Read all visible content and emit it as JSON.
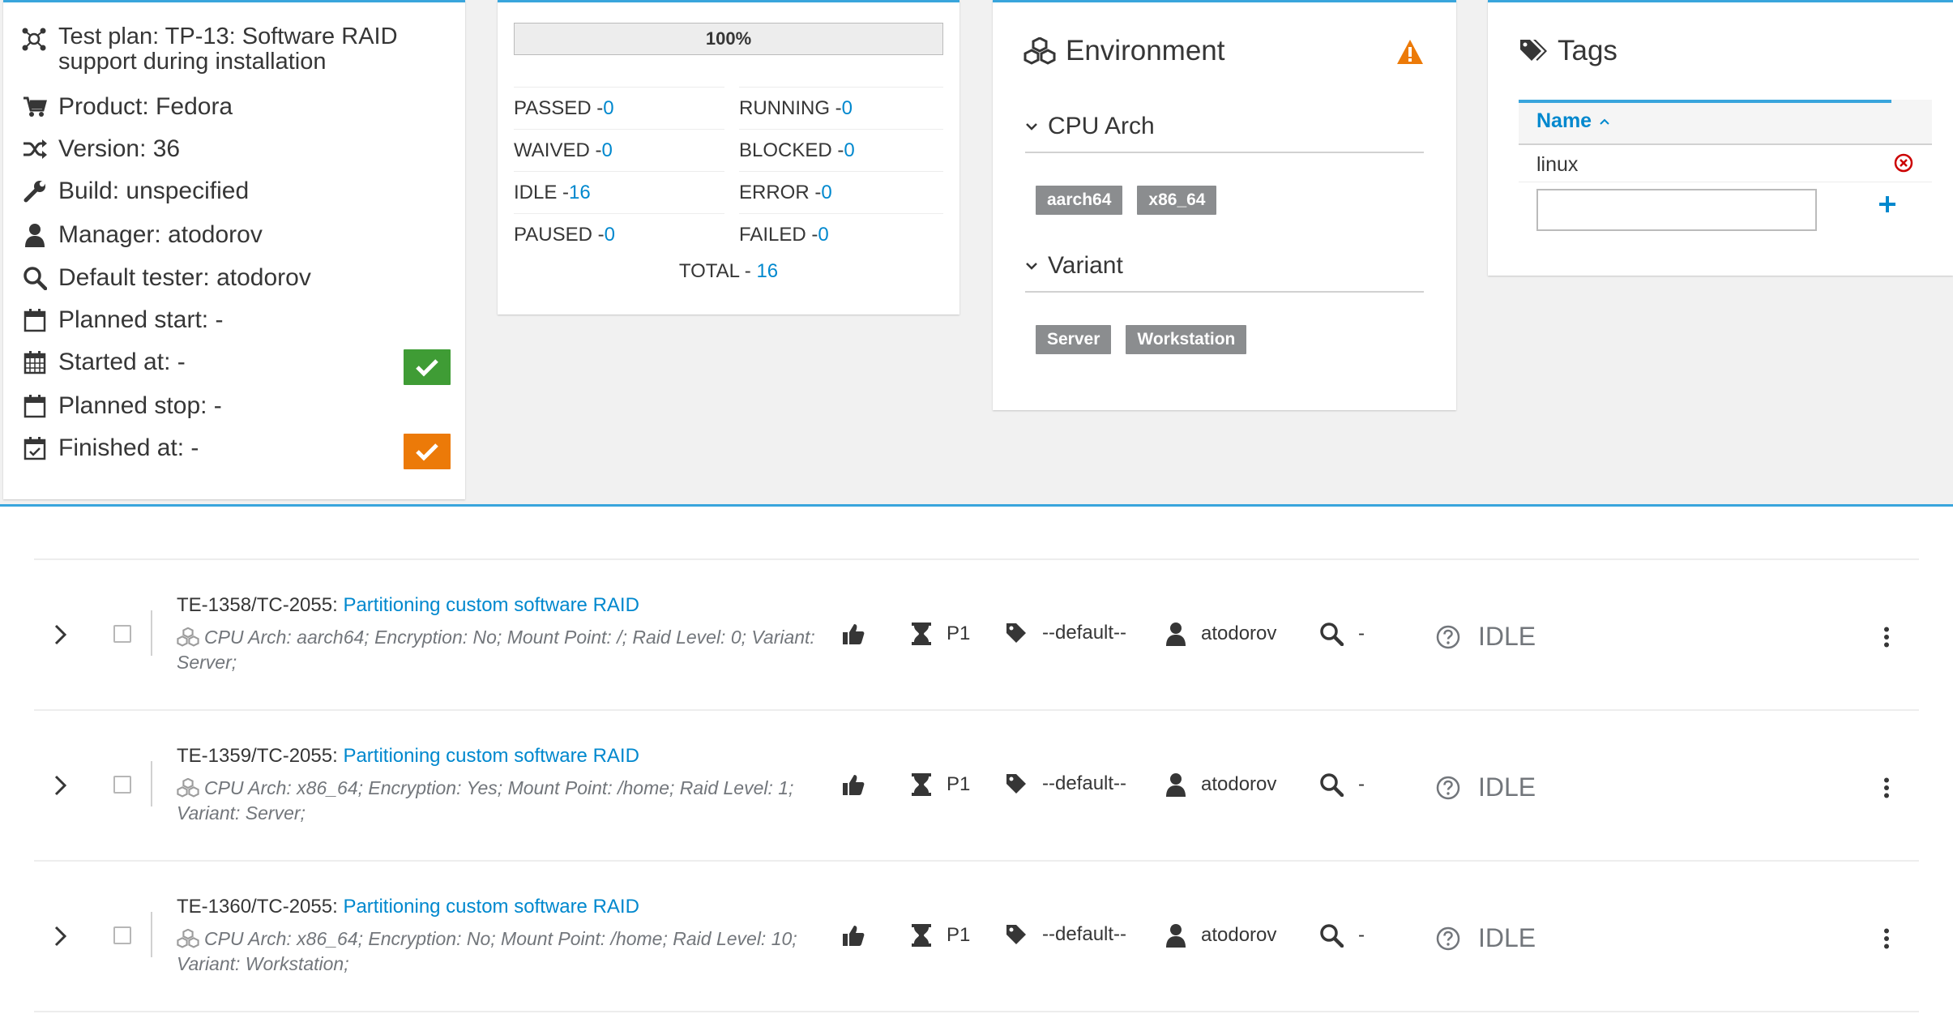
{
  "plan": {
    "title": "Test plan: TP-13: Software RAID support during installation",
    "product": "Product: Fedora",
    "version": "Version: 36",
    "build": "Build: unspecified",
    "manager": "Manager: atodorov",
    "default_tester": "Default tester: atodorov",
    "planned_start": "Planned start: -",
    "started_at": "Started at: -",
    "planned_stop": "Planned stop: -",
    "finished_at": "Finished at: -",
    "colors": {
      "start_button": "#3f9c35",
      "finish_button": "#ec7a08"
    }
  },
  "stats": {
    "progress": "100%",
    "progress_value": 1.0,
    "passed_label": "PASSED - ",
    "passed": "0",
    "waived_label": "WAIVED - ",
    "waived": "0",
    "idle_label": "IDLE - ",
    "idle": "16",
    "paused_label": "PAUSED - ",
    "paused": "0",
    "running_label": "RUNNING - ",
    "running": "0",
    "blocked_label": "BLOCKED - ",
    "blocked": "0",
    "error_label": "ERROR - ",
    "error": "0",
    "failed_label": "FAILED - ",
    "failed": "0",
    "total_label": "TOTAL - ",
    "total": "16"
  },
  "environment": {
    "title": "Environment",
    "warning_icon": "warning-triangle-icon",
    "sections": [
      {
        "name": "CPU Arch",
        "values": [
          "aarch64",
          "x86_64"
        ]
      },
      {
        "name": "Variant",
        "values": [
          "Server",
          "Workstation"
        ]
      }
    ]
  },
  "tags": {
    "title": "Tags",
    "column": "Name",
    "items": [
      "linux"
    ],
    "input_value": ""
  },
  "executions": [
    {
      "id": "TE-1358/TC-2055: ",
      "case": "Partitioning custom software RAID",
      "props": "CPU Arch: aarch64; Encryption: No; Mount Point: /; Raid Level: 0; Variant: Server;",
      "priority": "P1",
      "category": "--default--",
      "assignee": "atodorov",
      "tester": "-",
      "status": "IDLE"
    },
    {
      "id": "TE-1359/TC-2055: ",
      "case": "Partitioning custom software RAID",
      "props": "CPU Arch: x86_64; Encryption: Yes; Mount Point: /home; Raid Level: 1; Variant: Server;",
      "priority": "P1",
      "category": "--default--",
      "assignee": "atodorov",
      "tester": "-",
      "status": "IDLE"
    },
    {
      "id": "TE-1360/TC-2055: ",
      "case": "Partitioning custom software RAID",
      "props": "CPU Arch: x86_64; Encryption: No; Mount Point: /home; Raid Level: 10; Variant: Workstation;",
      "priority": "P1",
      "category": "--default--",
      "assignee": "atodorov",
      "tester": "-",
      "status": "IDLE"
    }
  ]
}
